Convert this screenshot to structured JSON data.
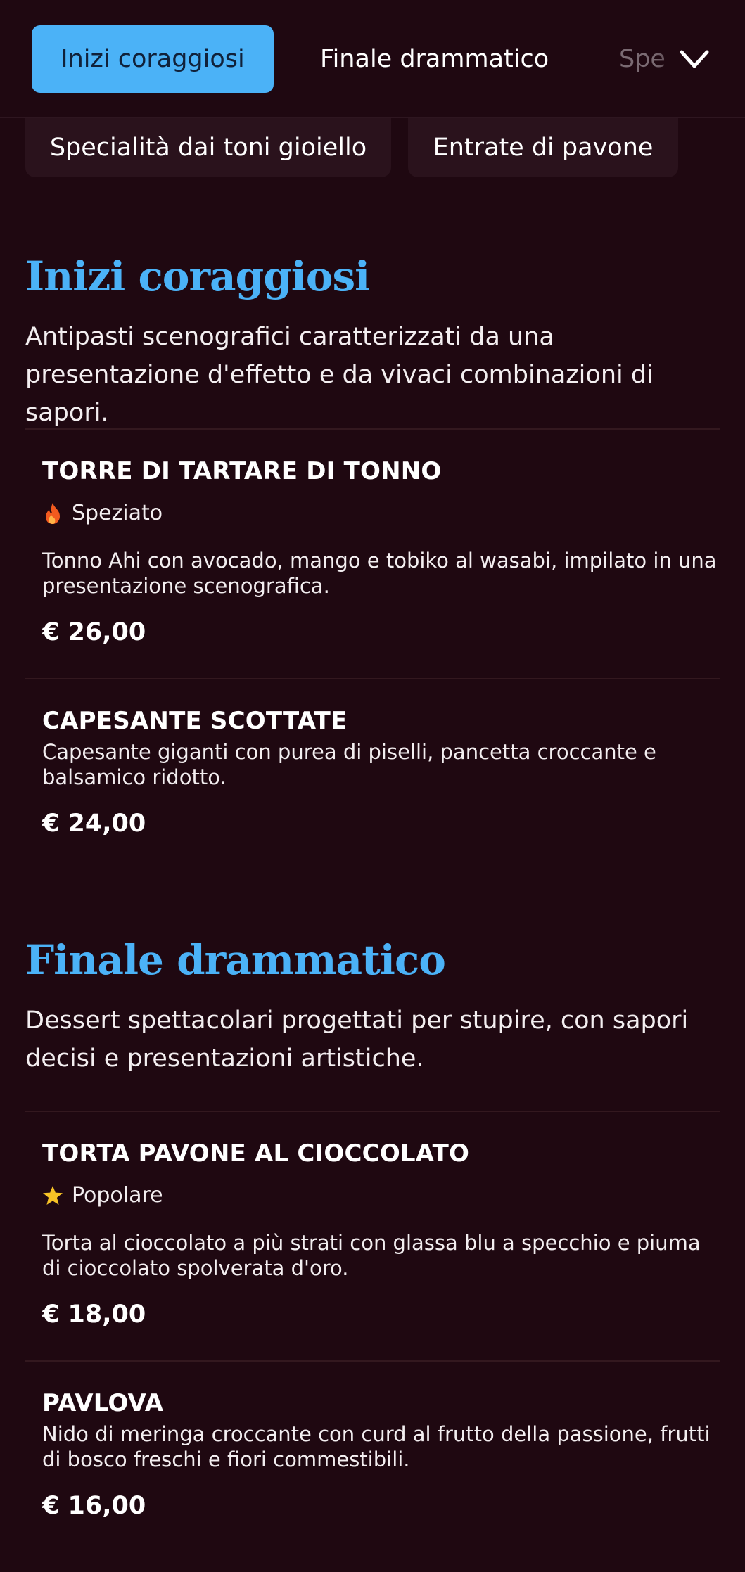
{
  "tabs": [
    {
      "label": "Inizi coraggiosi",
      "active": true
    },
    {
      "label": "Finale drammatico",
      "active": false
    },
    {
      "label": "Spe",
      "active": false
    }
  ],
  "chips": [
    {
      "label": "Specialità dai toni gioiello"
    },
    {
      "label": "Entrate di pavone"
    }
  ],
  "sections": [
    {
      "title": "Inizi coraggiosi",
      "description": "Antipasti scenografici caratterizzati da una presentazione d'effetto e da vivaci combinazioni di sapori.",
      "items": [
        {
          "name": "TORRE DI TARTARE DI TONNO",
          "badge": {
            "label": "Speziato",
            "icon": "fire-icon"
          },
          "description": "Tonno Ahi con avocado, mango e tobiko al wasabi, impilato in una presentazione scenografica.",
          "price": "€ 26,00"
        },
        {
          "name": "CAPESANTE SCOTTATE",
          "description": "Capesante giganti con purea di piselli, pancetta croccante e balsamico ridotto.",
          "price": "€ 24,00"
        }
      ]
    },
    {
      "title": "Finale drammatico",
      "description": "Dessert spettacolari progettati per stupire, con sapori decisi e presentazioni artistiche.",
      "items": [
        {
          "name": "TORTA PAVONE AL CIOCCOLATO",
          "badge": {
            "label": "Popolare",
            "icon": "star-icon"
          },
          "description": "Torta al cioccolato a più strati con glassa blu a specchio e piuma di cioccolato spolverata d'oro.",
          "price": "€ 18,00"
        },
        {
          "name": "PAVLOVA",
          "description": "Nido di meringa croccante con curd al frutto della passione, frutti di bosco freschi e fiori commestibili.",
          "price": "€ 16,00"
        }
      ]
    }
  ],
  "colors": {
    "background": "#1f0811",
    "accent": "#4bb2f7",
    "chip_background": "#2a121c",
    "text": "#ffffff"
  },
  "icons": {
    "menu_toggle": "chevron-down-icon"
  }
}
